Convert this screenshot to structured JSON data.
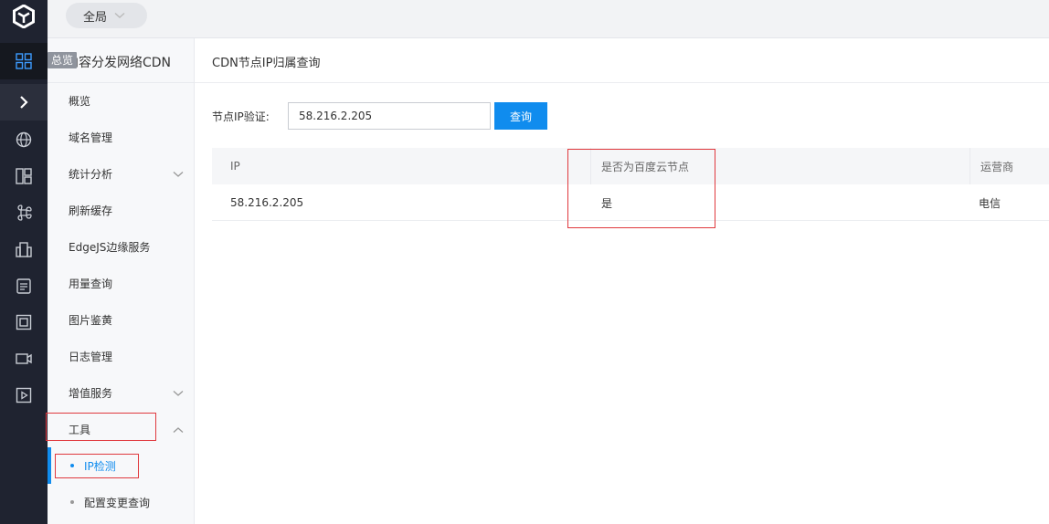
{
  "rail": {
    "items": [
      {
        "icon": "dashboard-icon"
      },
      {
        "icon": "expand-icon"
      },
      {
        "icon": "globe-icon"
      },
      {
        "icon": "layout-icon"
      },
      {
        "icon": "command-icon"
      },
      {
        "icon": "building-icon"
      },
      {
        "icon": "list-icon"
      },
      {
        "icon": "frame-icon"
      },
      {
        "icon": "camera-icon"
      },
      {
        "icon": "play-icon"
      }
    ]
  },
  "topbar": {
    "scope_label": "全局"
  },
  "sidebar": {
    "tooltip": "总览",
    "product_title": "内容分发网络CDN",
    "items": [
      {
        "label": "概览"
      },
      {
        "label": "域名管理"
      },
      {
        "label": "统计分析"
      },
      {
        "label": "刷新缓存"
      },
      {
        "label": "EdgeJS边缘服务"
      },
      {
        "label": "用量查询"
      },
      {
        "label": "图片鉴黄"
      },
      {
        "label": "日志管理"
      },
      {
        "label": "增值服务"
      },
      {
        "label": "工具"
      }
    ],
    "sub_items": [
      {
        "label": "IP检测"
      },
      {
        "label": "配置变更查询"
      }
    ]
  },
  "main": {
    "title": "CDN节点IP归属查询",
    "query_label": "节点IP验证:",
    "query_value": "58.216.2.205",
    "query_button": "查询",
    "table": {
      "headers": [
        "IP",
        "是否为百度云节点",
        "运营商"
      ],
      "rows": [
        [
          "58.216.2.205",
          "是",
          "电信"
        ]
      ]
    }
  },
  "colors": {
    "accent": "#108cee",
    "rail_bg": "#1f2330",
    "annotation": "#e0393e"
  }
}
